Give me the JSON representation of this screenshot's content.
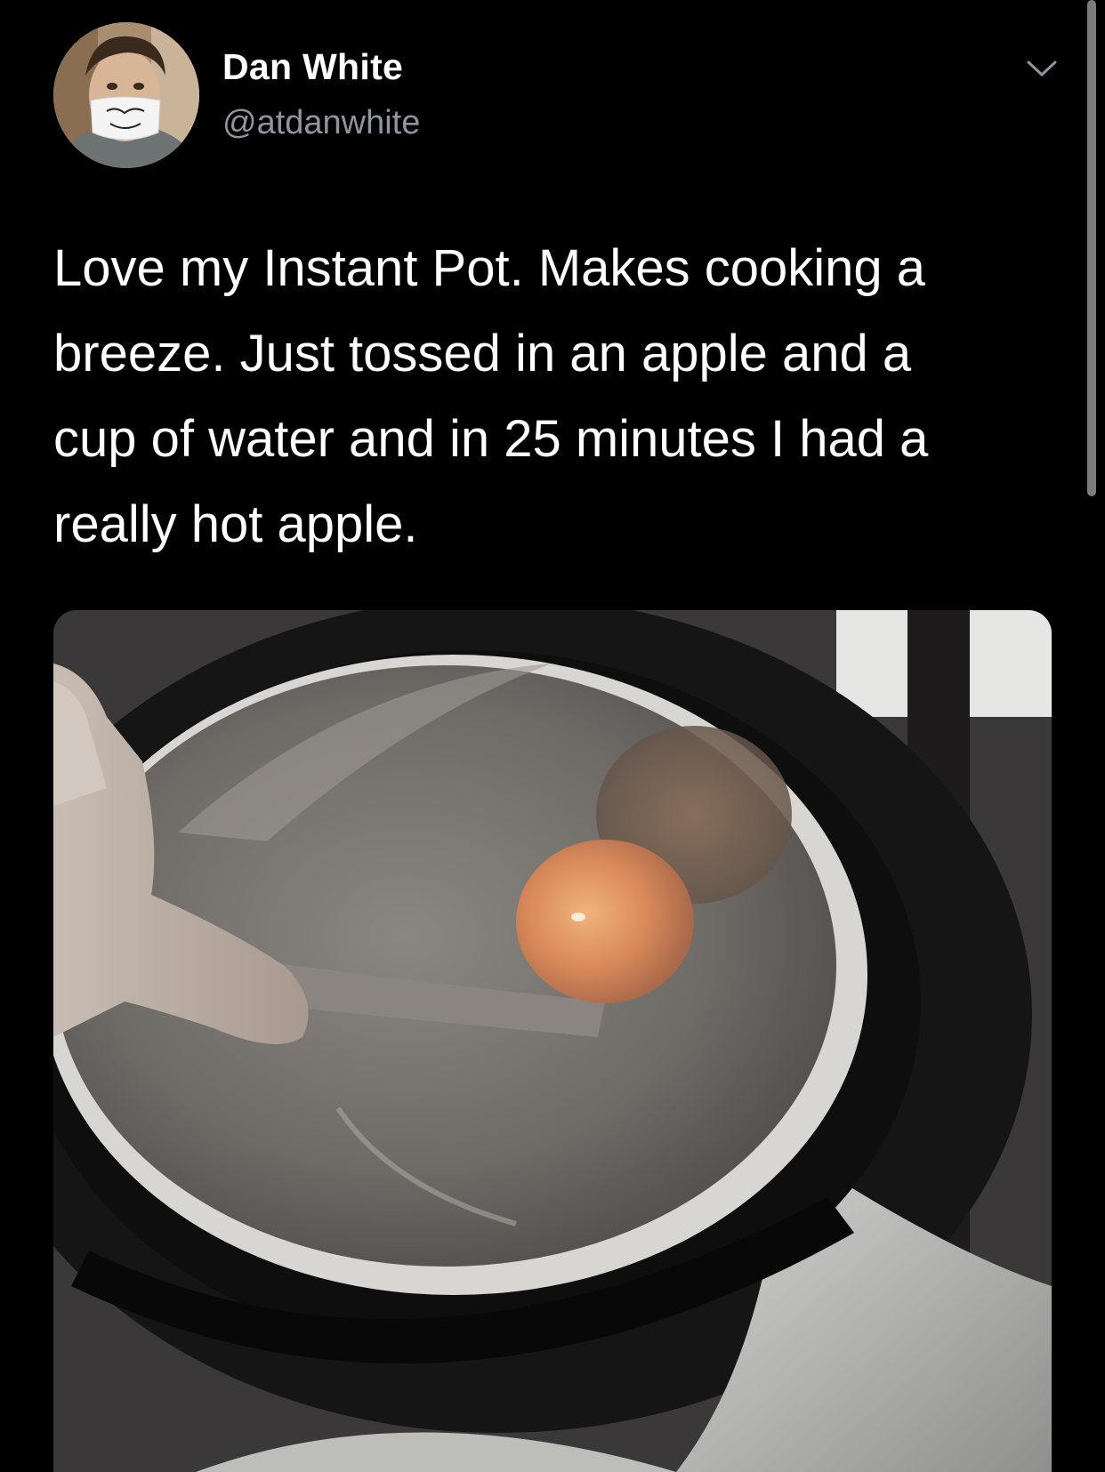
{
  "tweet": {
    "user": {
      "name": "Dan White",
      "handle": "@atdanwhite",
      "avatar_icon": "profile-photo"
    },
    "menu_icon": "chevron-down-icon",
    "text_lines": [
      "Love my Instant Pot. Makes cooking a",
      "breeze. Just tossed in an apple and a",
      "cup of water and in 25 minutes I had a",
      "really hot apple."
    ],
    "media": {
      "kind": "photo",
      "subject": "apple in water inside instant pot"
    }
  },
  "colors": {
    "background": "#000000",
    "text": "#ffffff",
    "handle": "#8e959c",
    "scrollbar": "#7b7b7b"
  }
}
